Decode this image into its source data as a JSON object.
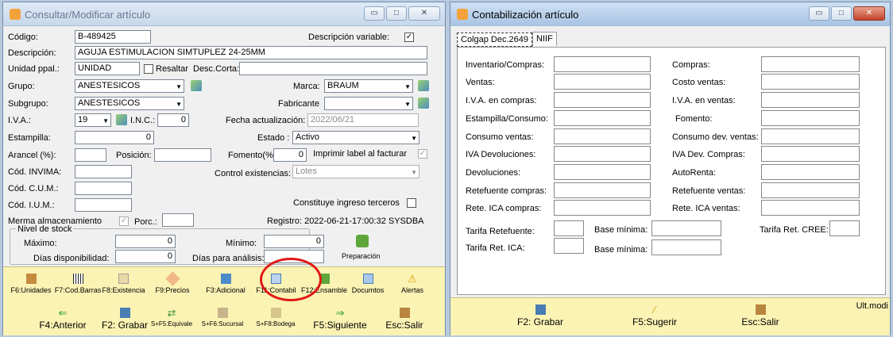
{
  "left_window": {
    "title": "Consultar/Modificar artículo",
    "controls": {
      "minimize": "▭",
      "maximize": "□",
      "close": "✕"
    },
    "codigo": {
      "label": "Código:",
      "value": "B-489425"
    },
    "desc_variable": {
      "label": "Descripción variable:",
      "checked": "✓"
    },
    "descripcion": {
      "label": "Descripción:",
      "value": "AGUJA ESTIMULACION SIMTUPLEZ 24-25MM"
    },
    "unidad": {
      "label": "Unidad ppal.:",
      "value": "UNIDAD",
      "resaltar_label": "Resaltar",
      "desc_corta_label": "Desc.Corta:",
      "desc_corta_value": ""
    },
    "grupo": {
      "label": "Grupo:",
      "value": "ANESTESICOS"
    },
    "marca": {
      "label": "Marca:",
      "value": "BRAUM"
    },
    "subgrupo": {
      "label": "Subgrupo:",
      "value": "ANESTESICOS"
    },
    "fabricante": {
      "label": "Fabricante",
      "value": ""
    },
    "iva": {
      "label": "I.V.A.:",
      "value": "19"
    },
    "inc": {
      "label": "I.N.C.:",
      "value": "0"
    },
    "fecha_act": {
      "label": "Fecha actualización:",
      "value": "2022/06/21"
    },
    "estampilla": {
      "label": "Estampilla:",
      "value": "0"
    },
    "estado": {
      "label": "Estado :",
      "value": "Activo"
    },
    "arancel": {
      "label": "Arancel (%):",
      "value": ""
    },
    "posicion": {
      "label": "Posición:",
      "value": ""
    },
    "fomento": {
      "label": "Fomento(%):",
      "value": "0"
    },
    "imprimir_label": {
      "label": "Imprimir label al facturar",
      "checked": "✓"
    },
    "cod_invima": {
      "label": "Cód. INVIMA:",
      "value": ""
    },
    "control_exist": {
      "label": "Control existencias:",
      "value": "Lotes"
    },
    "cod_cum": {
      "label": "Cód. C.U.M.:",
      "value": ""
    },
    "cod_ium": {
      "label": "Cód. I.U.M.:",
      "value": ""
    },
    "constituye": {
      "label": "Constituye ingreso terceros",
      "checked": ""
    },
    "merma": {
      "label": "Merma almacenamiento",
      "checked": "✓",
      "porc_label": "Porc.:",
      "porc_value": ""
    },
    "registro": "Registro: 2022-06-21-17:00:32 SYSDBA",
    "stock": {
      "legend": "Nivel de stock",
      "maximo_label": "Máximo:",
      "maximo_value": "0",
      "minimo_label": "Mínimo:",
      "minimo_value": "0",
      "dias_disp_label": "Días disponibilidad:",
      "dias_disp_value": "0",
      "dias_analisis_label": "Días para análisis:",
      "dias_analisis_value": "",
      "preparacion": "Preparación"
    },
    "toolbar_row1": [
      "F6:Unidades",
      "F7:Cod.Barras",
      "F8:Existencia",
      "F9:Precios",
      "F3:Adicional",
      "F11:Contabil",
      "F12:Ensamble",
      "Documtos",
      "Alertas"
    ],
    "toolbar_row2": [
      "F4:Anterior",
      "F2: Grabar",
      "S+F5:Equivale",
      "S+F6:Sucursal",
      "S+F8:Bodega",
      "F5:Siguiente",
      "Esc:Salir"
    ],
    "highlight_color": "#e01818"
  },
  "right_window": {
    "title": "Contabilización artículo",
    "controls": {
      "minimize": "▭",
      "maximize": "□",
      "close": "✕"
    },
    "tabs": [
      "Colgap Dec.2649",
      "NIIF"
    ],
    "left_fields": [
      "Inventario/Compras:",
      "Ventas:",
      "I.V.A. en compras:",
      "Estampilla/Consumo:",
      "Consumo ventas:",
      "IVA Devoluciones:",
      "Devoluciones:",
      "Retefuente compras:",
      "Rete. ICA compras:"
    ],
    "right_fields": [
      "Compras:",
      "Costo ventas:",
      "I.V.A. en ventas:",
      "Fomento:",
      "Consumo dev. ventas:",
      "IVA Dev. Compras:",
      "AutoRenta:",
      "Retefuente ventas:",
      "Rete. ICA ventas:"
    ],
    "tarifa_retefuente": "Tarifa Retefuente:",
    "base_minima_1": "Base mínima:",
    "tarifa_cree": "Tarifa Ret. CREE:",
    "tarifa_ica": "Tarifa Ret. ICA:",
    "base_minima_2": "Base mínima:",
    "ult_modif": "Ult.modi",
    "toolbar": [
      "F2: Grabar",
      "F5:Sugerir",
      "Esc:Salir"
    ]
  }
}
